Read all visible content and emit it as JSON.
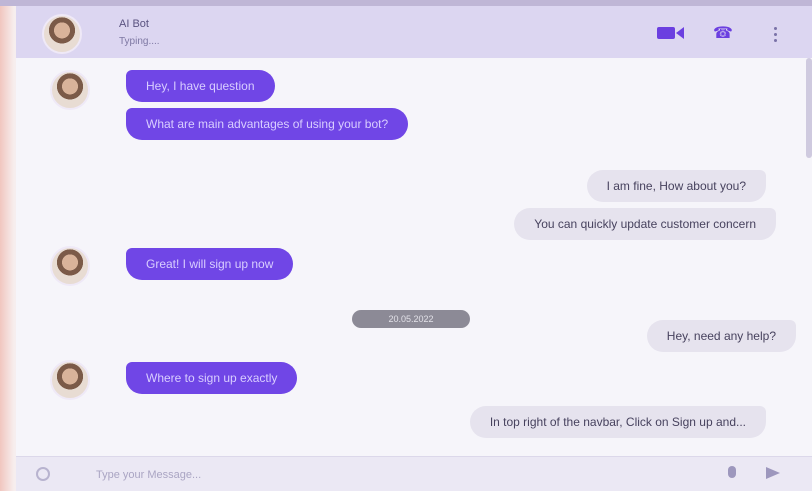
{
  "header": {
    "bot_name": "AI Bot",
    "status": "Typing...."
  },
  "messages": [
    {
      "sender": "bot",
      "text": "Hey, I have question"
    },
    {
      "sender": "bot",
      "text": "What are main advantages of using your bot?"
    },
    {
      "sender": "user",
      "text": "I am fine, How about you?"
    },
    {
      "sender": "user",
      "text": "You can quickly update customer concern"
    },
    {
      "sender": "bot",
      "text": "Great! I will sign up now"
    },
    {
      "sender": "user",
      "text": "Hey, need any help?"
    },
    {
      "sender": "bot",
      "text": "Where to sign up exactly"
    },
    {
      "sender": "user",
      "text": "In top right of the navbar, Click on Sign up and..."
    }
  ],
  "date_divider": "20.05.2022",
  "composer": {
    "placeholder": "Type your Message..."
  },
  "colors": {
    "accent": "#7046e6",
    "user_bubble": "#e6e3ee"
  }
}
